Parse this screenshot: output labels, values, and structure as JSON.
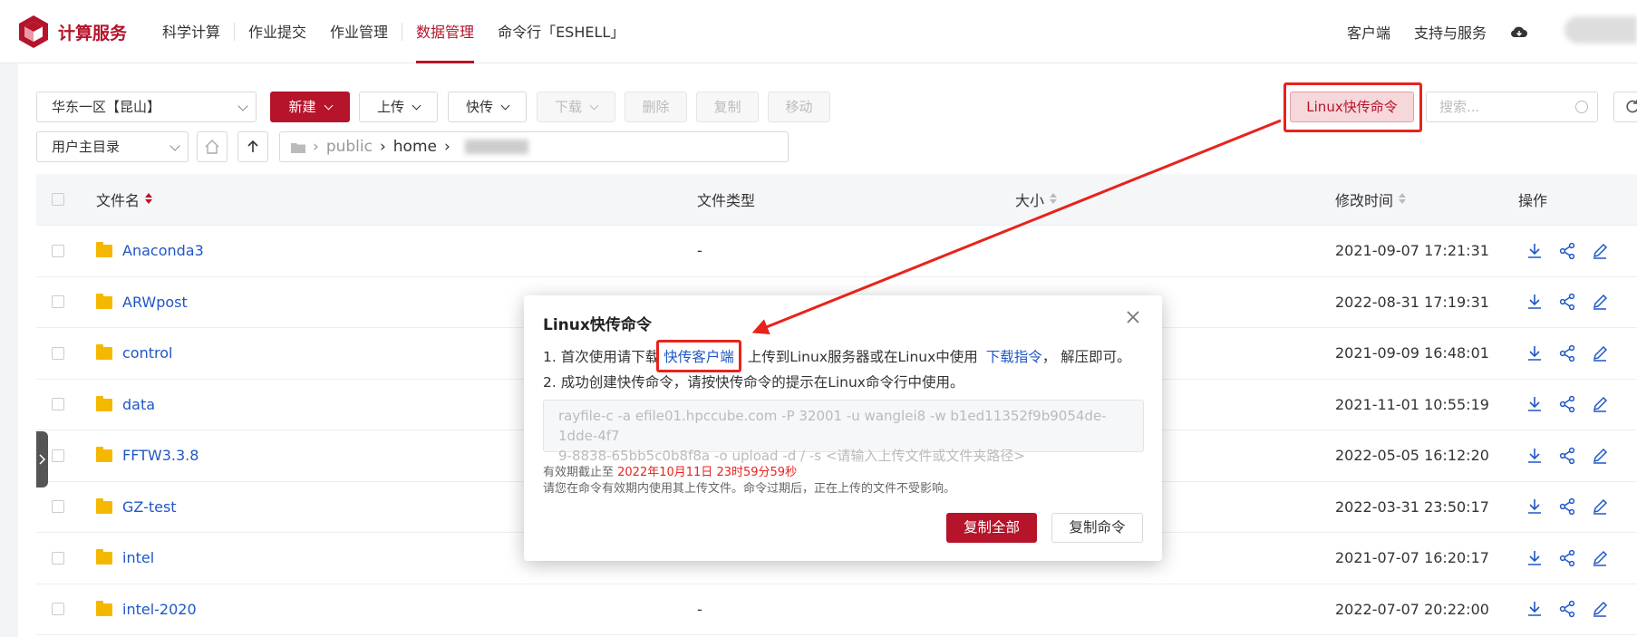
{
  "nav": {
    "brand": "计算服务",
    "items": [
      "科学计算",
      "作业提交",
      "作业管理",
      "数据管理",
      "命令行「ESHELL」"
    ],
    "active_index": 3,
    "right_items": [
      "客户端",
      "支持与服务"
    ]
  },
  "toolbar": {
    "region": "华东一区【昆山】",
    "new_label": "新建",
    "upload_label": "上传",
    "fast_label": "快传",
    "download_label": "下载",
    "delete_label": "删除",
    "copy_label": "复制",
    "move_label": "移动",
    "linux_cmd_label": "Linux快传命令",
    "search_placeholder": "搜索..."
  },
  "pathbar": {
    "root_select": "用户主目录",
    "crumbs": [
      "public",
      "home"
    ]
  },
  "table": {
    "headers": {
      "name": "文件名",
      "type": "文件类型",
      "size": "大小",
      "mtime": "修改时间",
      "ops": "操作"
    },
    "rows": [
      {
        "name": "Anaconda3",
        "type": "-",
        "mtime": "2021-09-07 17:21:31"
      },
      {
        "name": "ARWpost",
        "type": "",
        "mtime": "2022-08-31 17:19:31"
      },
      {
        "name": "control",
        "type": "",
        "mtime": "2021-09-09 16:48:01"
      },
      {
        "name": "data",
        "type": "",
        "mtime": "2021-11-01 10:55:19"
      },
      {
        "name": "FFTW3.3.8",
        "type": "",
        "mtime": "2022-05-05 16:12:20"
      },
      {
        "name": "GZ-test",
        "type": "",
        "mtime": "2022-03-31 23:50:17"
      },
      {
        "name": "intel",
        "type": "",
        "mtime": "2021-07-07 16:20:17"
      },
      {
        "name": "intel-2020",
        "type": "-",
        "mtime": "2022-07-07 20:22:00"
      }
    ]
  },
  "modal": {
    "title": "Linux快传命令",
    "line1_prefix": "1. 首次使用请下载",
    "line1_link1": "快传客户端",
    "line1_middle": "上传到Linux服务器或在Linux中使用",
    "line1_link2": "下载指令",
    "line1_suffix": "，  解压即可。",
    "line2": "2. 成功创建快传命令，请按快传命令的提示在Linux命令行中使用。",
    "command_line1": "rayfile-c -a efile01.hpccube.com -P 32001 -u wanglei8 -w b1ed11352f9b9054de-1dde-4f7",
    "command_line2": "9-8838-65bb5c0b8f8a -o upload -d / -s <请输入上传文件或文件夹路径>",
    "expiry_prefix": "有效期截止至 ",
    "expiry_value": "2022年10月11日 23时59分59秒",
    "note": "请您在命令有效期内使用其上传文件。命令过期后，正在上传的文件不受影响。",
    "copy_all_label": "复制全部",
    "copy_cmd_label": "复制命令"
  },
  "colors": {
    "brand": "#b5142b",
    "link": "#1f57c6",
    "annotation": "#e8231b",
    "folder": "#f5b800"
  }
}
